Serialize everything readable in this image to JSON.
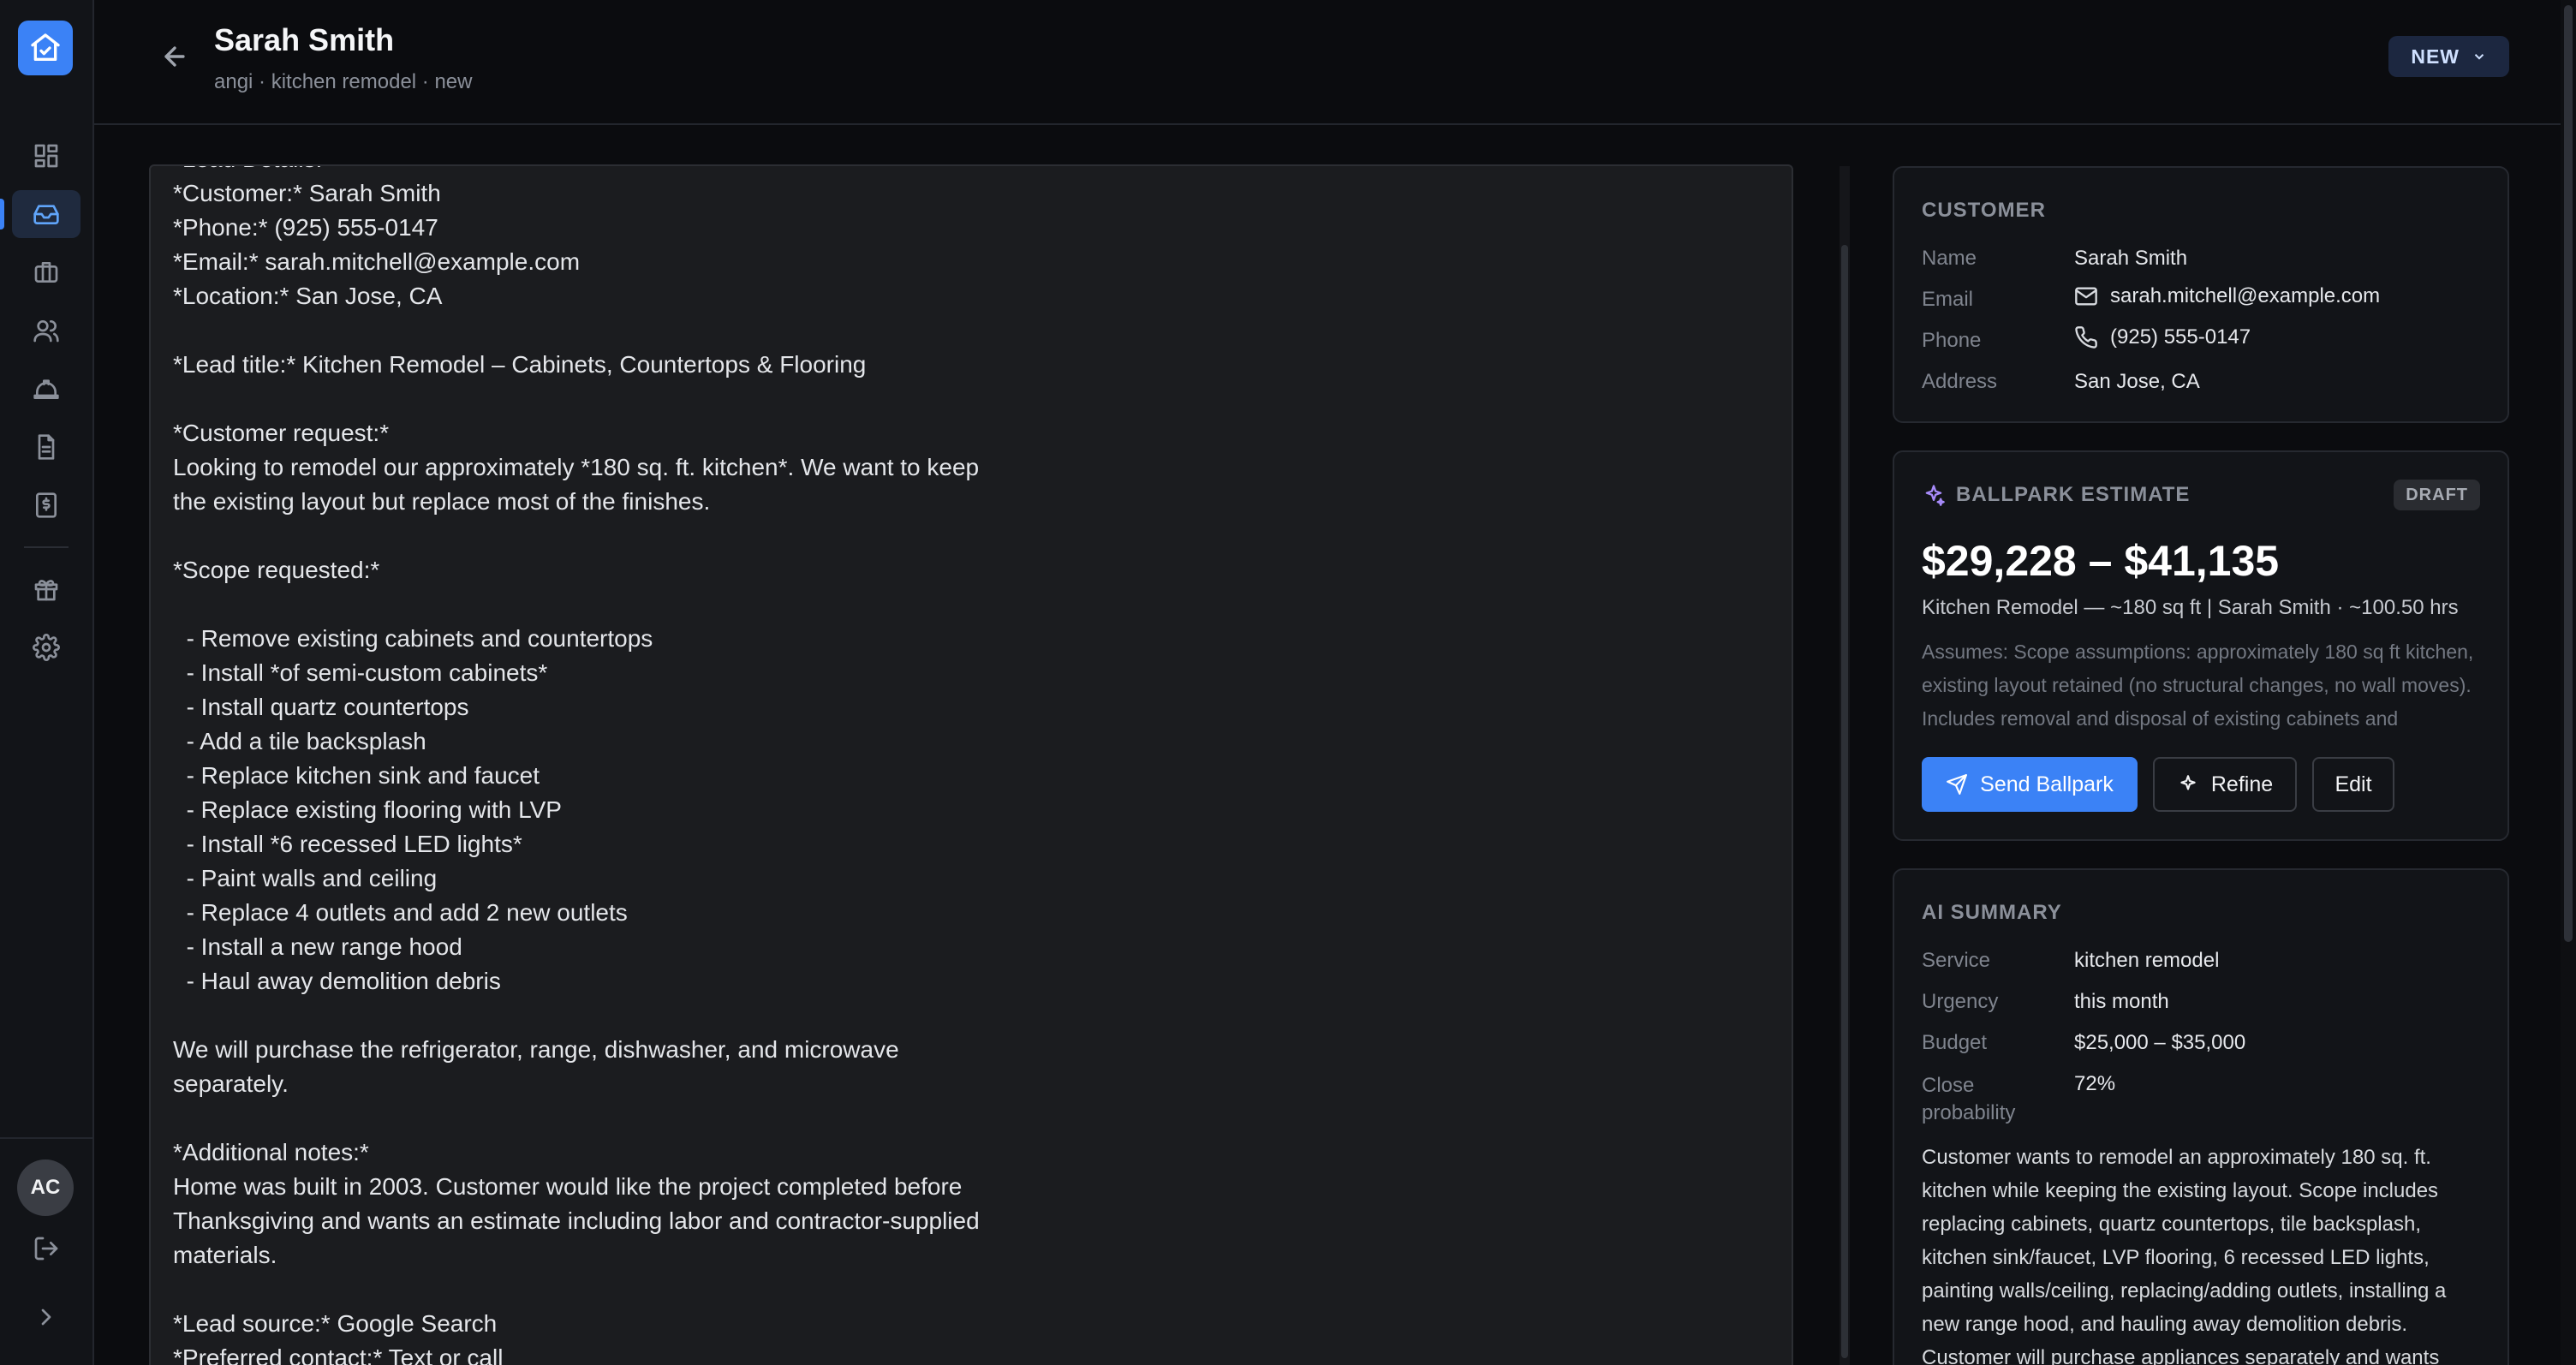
{
  "sidebar": {
    "logo_icon": "house-check-icon",
    "items": [
      {
        "icon": "dashboard-icon"
      },
      {
        "icon": "inbox-icon"
      },
      {
        "icon": "briefcase-icon"
      },
      {
        "icon": "users-icon"
      },
      {
        "icon": "hard-hat-icon"
      },
      {
        "icon": "document-icon"
      },
      {
        "icon": "invoice-icon"
      },
      {
        "icon": "gift-icon"
      },
      {
        "icon": "gear-icon"
      }
    ],
    "active_index": 1,
    "avatar_initials": "AC"
  },
  "header": {
    "title": "Sarah Smith",
    "subtitle": "angi · kitchen remodel · new",
    "status": "NEW"
  },
  "lead_message": "*Lead Details:*\n*Customer:* Sarah Smith\n*Phone:* (925) 555-0147\n*Email:* sarah.mitchell@example.com\n*Location:* San Jose, CA\n\n*Lead title:* Kitchen Remodel – Cabinets, Countertops & Flooring\n\n*Customer request:*\nLooking to remodel our approximately *180 sq. ft. kitchen*. We want to keep\nthe existing layout but replace most of the finishes.\n\n*Scope requested:*\n\n  - Remove existing cabinets and countertops\n  - Install *of semi-custom cabinets*\n  - Install quartz countertops\n  - Add a tile backsplash\n  - Replace kitchen sink and faucet\n  - Replace existing flooring with LVP\n  - Install *6 recessed LED lights*\n  - Paint walls and ceiling\n  - Replace 4 outlets and add 2 new outlets\n  - Install a new range hood\n  - Haul away demolition debris\n\nWe will purchase the refrigerator, range, dishwasher, and microwave\nseparately.\n\n*Additional notes:*\nHome was built in 2003. Customer would like the project completed before\nThanksgiving and wants an estimate including labor and contractor-supplied\nmaterials.\n\n*Lead source:* Google Search\n*Preferred contact:* Text or call",
  "customer": {
    "heading": "CUSTOMER",
    "name_label": "Name",
    "name": "Sarah Smith",
    "email_label": "Email",
    "email": "sarah.mitchell@example.com",
    "phone_label": "Phone",
    "phone": "(925) 555-0147",
    "address_label": "Address",
    "address": "San Jose, CA"
  },
  "estimate": {
    "heading": "BALLPARK ESTIMATE",
    "badge": "DRAFT",
    "range": "$29,228 – $41,135",
    "meta": "Kitchen Remodel — ~180 sq ft | Sarah Smith · ~100.50 hrs",
    "assumptions": "Assumes: Scope assumptions: approximately 180 sq ft kitchen, existing layout retained (no structural changes, no wall moves). Includes removal and disposal of existing cabinets and countertops.",
    "send_label": "Send Ballpark",
    "refine_label": "Refine",
    "edit_label": "Edit",
    "accent_color": "#3b82f6"
  },
  "ai_summary": {
    "heading": "AI SUMMARY",
    "service_label": "Service",
    "service": "kitchen remodel",
    "urgency_label": "Urgency",
    "urgency": "this month",
    "budget_label": "Budget",
    "budget": "$25,000 – $35,000",
    "close_label": "Close probability",
    "close": "72%",
    "text": "Customer wants to remodel an approximately 180 sq. ft. kitchen while keeping the existing layout. Scope includes replacing cabinets, quartz countertops, tile backsplash, kitchen sink/faucet, LVP flooring, 6 recessed LED lights, painting walls/ceiling, replacing/adding outlets, installing a new range hood, and hauling away demolition debris. Customer will purchase appliances separately and wants"
  }
}
